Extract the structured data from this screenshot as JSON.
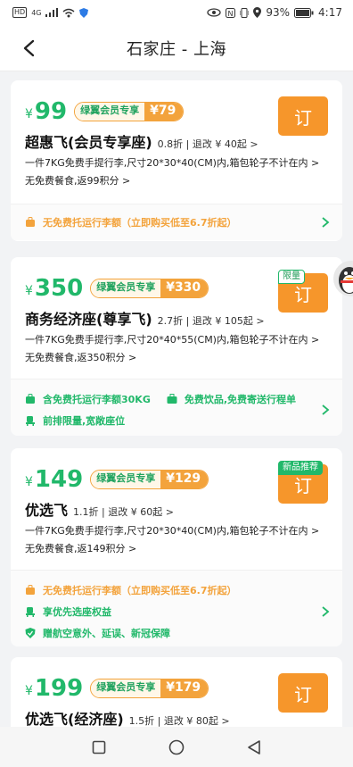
{
  "status_bar": {
    "carrier_badge": "HD",
    "signal": "4G",
    "battery_text": "93%",
    "time": "4:17"
  },
  "header": {
    "title": "石家庄 - 上海"
  },
  "fares": [
    {
      "yen": "¥",
      "price": "99",
      "vip_label": "绿翼会员专享",
      "vip_price": "¥79",
      "name": "超惠飞(会员专享座)",
      "meta": "0.8折 | 退改 ¥ 40起 >",
      "line1": "一件7KG免费手提行李,尺寸20*30*40(CM)内,箱包轮子不计在内 >",
      "line2": "无免费餐食,返99积分 >",
      "book": "订",
      "badge": "",
      "perks": [
        {
          "icon": "baggage-icon",
          "text": "无免费托运行李额（立即购买低至6.7折起）",
          "color": "orange"
        }
      ]
    },
    {
      "yen": "¥",
      "price": "350",
      "vip_label": "绿翼会员专享",
      "vip_price": "¥330",
      "name": "商务经济座(尊享飞)",
      "meta": "2.7折 | 退改 ¥ 105起 >",
      "line1": "一件7KG免费手提行李,尺寸20*40*55(CM)内,箱包轮子不计在内 >",
      "line2": "无免费餐食,返350积分 >",
      "book": "订",
      "badge": "限量",
      "perks": [
        {
          "icon": "baggage-icon",
          "text": "含免费托运行李额30KG",
          "color": "green"
        },
        {
          "icon": "briefcase-icon",
          "text": "免费饮品,免费寄送行程单",
          "color": "green"
        },
        {
          "icon": "seat-icon",
          "text": "前排限量,宽敞座位",
          "color": "green"
        }
      ]
    },
    {
      "yen": "¥",
      "price": "149",
      "vip_label": "绿翼会员专享",
      "vip_price": "¥129",
      "name": "优选飞",
      "meta": "1.1折 | 退改 ¥ 60起 >",
      "line1": "一件7KG免费手提行李,尺寸20*30*40(CM)内,箱包轮子不计在内 >",
      "line2": "无免费餐食,返149积分 >",
      "book": "订",
      "badge": "新品推荐",
      "perks": [
        {
          "icon": "baggage-icon",
          "text": "无免费托运行李额（立即购买低至6.7折起）",
          "color": "orange"
        },
        {
          "icon": "seat-icon",
          "text": "享优先选座权益",
          "color": "green"
        },
        {
          "icon": "shield-icon",
          "text": "赠航空意外、延误、新冠保障",
          "color": "green"
        }
      ]
    },
    {
      "yen": "¥",
      "price": "199",
      "vip_label": "绿翼会员专享",
      "vip_price": "¥179",
      "name": "优选飞(经济座)",
      "meta": "1.5折 | 退改 ¥ 80起 >",
      "book": "订"
    }
  ]
}
